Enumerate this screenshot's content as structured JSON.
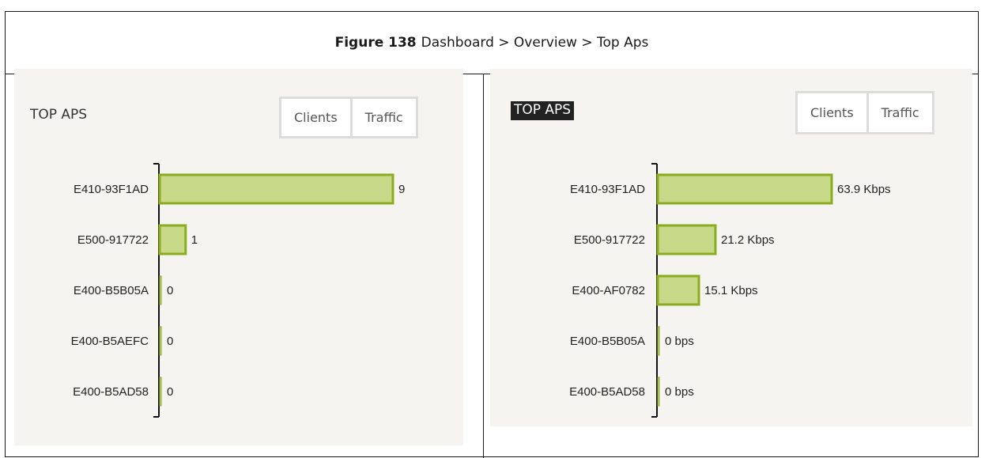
{
  "caption": {
    "label": "Figure 138",
    "text": "Dashboard > Overview > Top Aps"
  },
  "colors": {
    "bar_fill": "#c9d98a",
    "bar_stroke": "#8aac1e",
    "axis": "#111111",
    "title_highlight_bg": "#222222"
  },
  "panels": [
    {
      "title": "TOP APS",
      "toggle": [
        "Clients",
        "Traffic"
      ]
    },
    {
      "title": "TOP APS",
      "toggle": [
        "Clients",
        "Traffic"
      ]
    }
  ],
  "chart_data": [
    {
      "type": "bar",
      "orientation": "horizontal",
      "categories": [
        "E410-93F1AD",
        "E500-917722",
        "E400-B5B05A",
        "E400-B5AEFC",
        "E400-B5AD58"
      ],
      "values": [
        9,
        1,
        0,
        0,
        0
      ],
      "value_labels": [
        "9",
        "1",
        "0",
        "0",
        "0"
      ],
      "xlim": [
        0,
        9
      ]
    },
    {
      "type": "bar",
      "orientation": "horizontal",
      "categories": [
        "E410-93F1AD",
        "E500-917722",
        "E400-AF0782",
        "E400-B5B05A",
        "E400-B5AD58"
      ],
      "values": [
        63.9,
        21.2,
        15.1,
        0,
        0
      ],
      "unit": "Kbps",
      "value_labels": [
        "63.9 Kbps",
        "21.2 Kbps",
        "15.1 Kbps",
        "0 bps",
        "0 bps"
      ],
      "xlim": [
        0,
        63.9
      ]
    }
  ]
}
